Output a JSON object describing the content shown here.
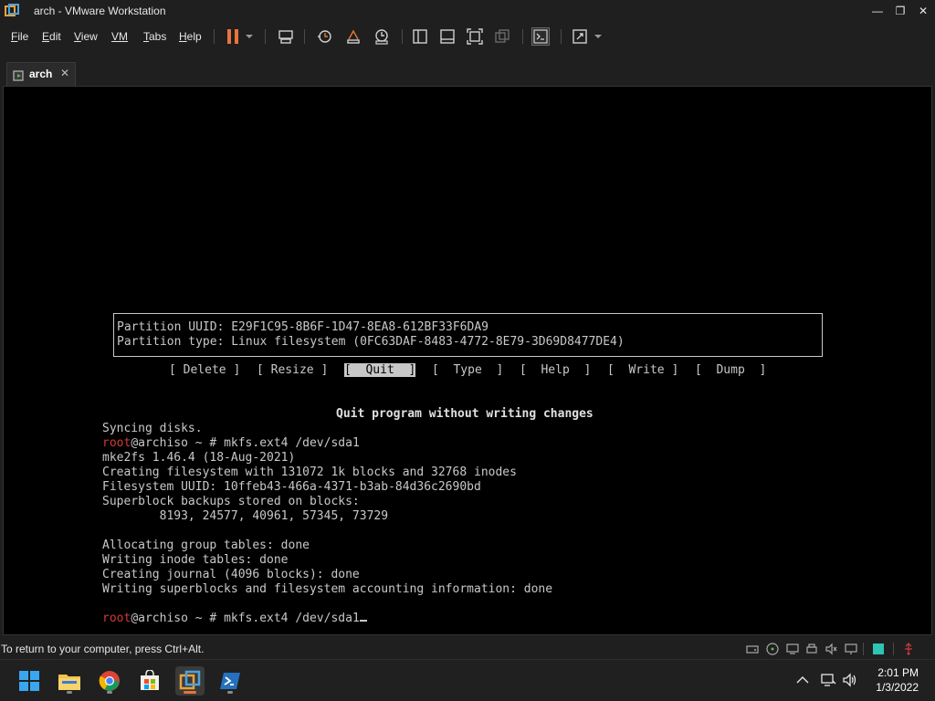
{
  "window": {
    "title": "arch - VMware Workstation",
    "minimize_glyph": "—",
    "maximize_glyph": "❐",
    "close_glyph": "✕"
  },
  "menu": {
    "file": {
      "u": "F",
      "rest": "ile"
    },
    "edit": {
      "u": "E",
      "rest": "dit"
    },
    "view": {
      "u": "V",
      "rest": "iew"
    },
    "vm": {
      "u": "VM",
      "rest": ""
    },
    "tabs": {
      "u": "T",
      "rest": "abs"
    },
    "help": {
      "u": "H",
      "rest": "elp"
    }
  },
  "tab": {
    "label": "arch",
    "close_glyph": "✕"
  },
  "terminal": {
    "partition_uuid": "Partition UUID: E29F1C95-8B6F-1D47-8EA8-612BF33F6DA9",
    "partition_type": "Partition type: Linux filesystem (0FC63DAF-8483-4772-8E79-3D69D8477DE4)",
    "options": [
      "[ Delete ]",
      "[ Resize ]",
      "[  Quit  ]",
      "[  Type  ]",
      "[  Help  ]",
      "[  Write ]",
      "[  Dump  ]"
    ],
    "options_render": {
      "delete": "[ Delete ]",
      "resize": "[ Resize ]",
      "quit_l": "[",
      "quit": "  Quit  ",
      "quit_r": "]",
      "type": "[  Type  ]",
      "help": "[  Help  ]",
      "write": "[  Write ]",
      "dump": "[  Dump  ]"
    },
    "hint": "Quit program without writing changes",
    "lines": [
      "Syncing disks.",
      "mke2fs 1.46.4 (18-Aug-2021)",
      "Creating filesystem with 131072 1k blocks and 32768 inodes",
      "Filesystem UUID: 10ffeb43-466a-4371-b3ab-84d36c2690bd",
      "Superblock backups stored on blocks:",
      "        8193, 24577, 40961, 57345, 73729",
      "Allocating group tables: done",
      "Writing inode tables: done",
      "Creating journal (4096 blocks): done",
      "Writing superblocks and filesystem accounting information: done"
    ],
    "prompt_user": "root",
    "prompt_host": "@archiso ~ # ",
    "command": "mkfs.ext4 /dev/sda1"
  },
  "statusbar": {
    "text": "To return to your computer, press Ctrl+Alt."
  },
  "clock": {
    "time": "2:01 PM",
    "date": "1/3/2022"
  },
  "colors": {
    "prompt_root": "#d23a3a",
    "terminal_fg": "#c8c8c8",
    "chrome_bg": "#1f1f1f",
    "accent_orange": "#e8743b"
  }
}
